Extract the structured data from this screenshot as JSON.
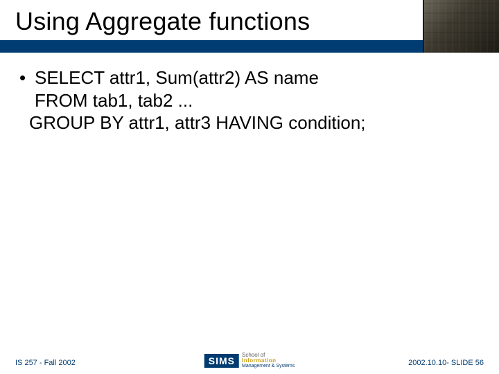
{
  "title": "Using Aggregate functions",
  "body": {
    "line1": "SELECT attr1, Sum(attr2) AS name",
    "line2": "FROM tab1, tab2 ...",
    "line3": "GROUP BY attr1, attr3  HAVING condition;"
  },
  "bullet": "•",
  "footer": {
    "left": "IS 257 - Fall 2002",
    "right": "2002.10.10- SLIDE 56",
    "center": {
      "logo": "SIMS",
      "l1": "School of",
      "l2": "Information",
      "l3": "Management & Systems"
    }
  }
}
